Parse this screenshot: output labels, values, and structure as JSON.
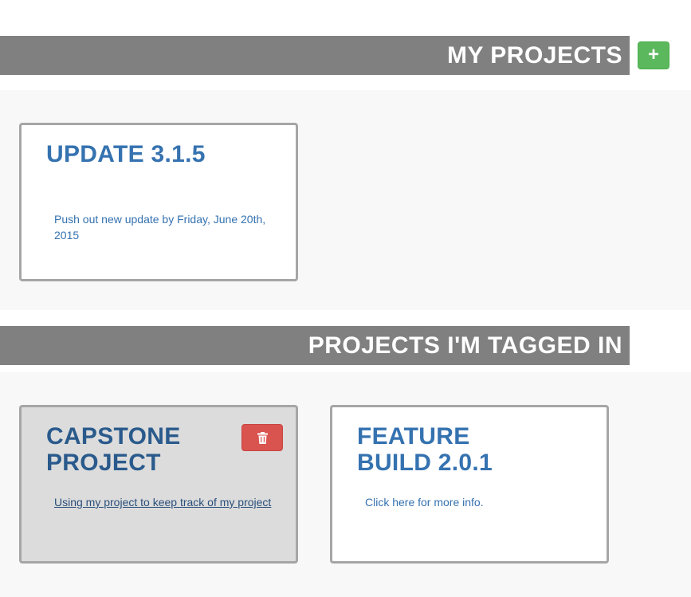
{
  "my_projects": {
    "header": "MY PROJECTS",
    "add_button": "+",
    "projects": [
      {
        "title": "UPDATE 3.1.5",
        "description": "Push out new update by Friday, June 20th, 2015"
      }
    ]
  },
  "tagged_projects": {
    "header": "PROJECTS I'M TAGGED IN",
    "projects": [
      {
        "title": "CAPSTONE PROJECT",
        "description": "Using my project to keep track of my project",
        "delete_icon": "trash-icon"
      },
      {
        "title": "FEATURE BUILD 2.0.1",
        "description": "Click here for more info."
      }
    ]
  },
  "colors": {
    "header_bg": "#808080",
    "add_button": "#5cb85c",
    "delete_button": "#d9534f",
    "link_blue": "#3572b0"
  }
}
